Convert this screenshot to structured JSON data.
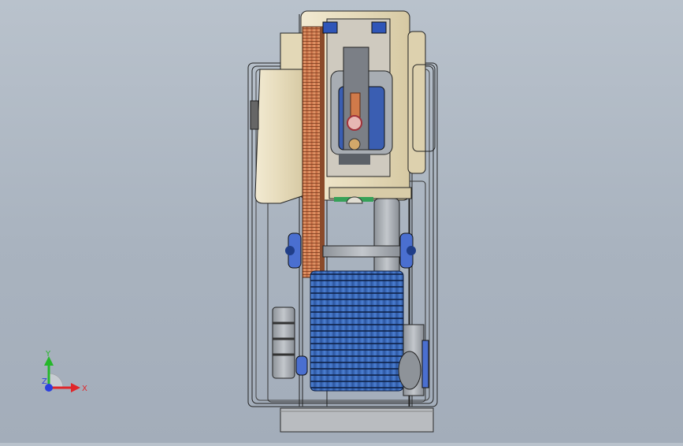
{
  "viewport": {
    "background_top": "#b9c2cc",
    "background_bottom": "#a3adba"
  },
  "model": {
    "components": [
      "frame-body",
      "gear-housing",
      "large-gear",
      "motor",
      "punch-assembly",
      "flywheel",
      "blue-bearing",
      "v-belt-pulley",
      "base-plate"
    ],
    "colors": {
      "housing": "#eae0c4",
      "gear": "#d98a5c",
      "motor": "#3f6fc0",
      "bearing": "#4a6fd0",
      "steel": "#9ea3aa",
      "base": "#b9bcc0"
    }
  },
  "triad": {
    "x_label": "X",
    "y_label": "Y",
    "z_label": "Z",
    "x_color": "#e0262a",
    "y_color": "#25b72a",
    "z_color": "#2a3fe0"
  }
}
